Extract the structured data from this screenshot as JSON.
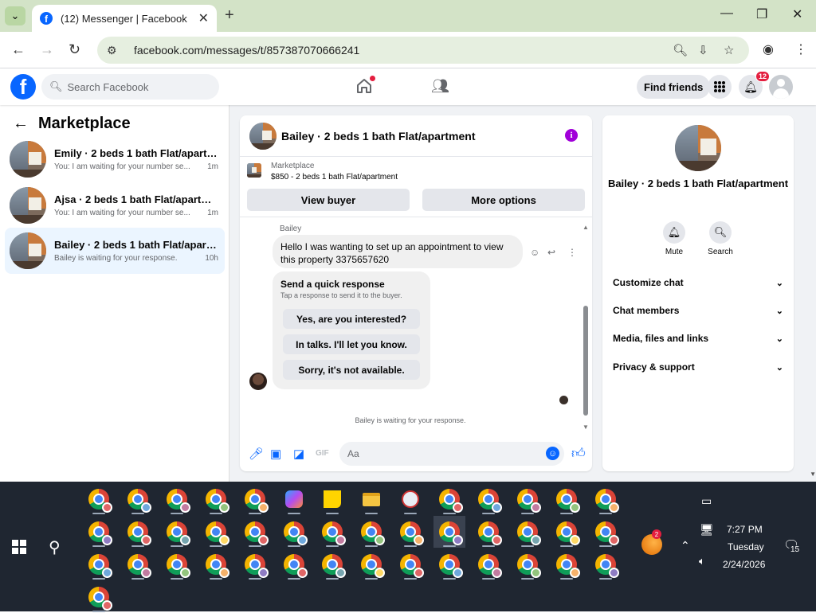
{
  "browser": {
    "tab_title": "(12) Messenger | Facebook",
    "url": "facebook.com/messages/t/857387070666241"
  },
  "fb_header": {
    "search_placeholder": "Search Facebook",
    "find_friends": "Find friends",
    "notification_count": "12"
  },
  "left": {
    "title": "Marketplace",
    "conversations": [
      {
        "name": "Emily · 2 beds 1 bath Flat/apartment",
        "snippet": "You: I am waiting for your number se...",
        "time": "1m",
        "active": false
      },
      {
        "name": "Ajsa · 2 beds 1 bath Flat/apartment",
        "snippet": "You: I am waiting for your number se...",
        "time": "1m",
        "active": false
      },
      {
        "name": "Bailey · 2 beds 1 bath Flat/apartme...",
        "snippet": "Bailey is waiting for your response.",
        "time": "10h",
        "active": true
      }
    ]
  },
  "chat": {
    "title": "Bailey · 2 beds 1 bath Flat/apartment",
    "marketplace_label": "Marketplace",
    "listing": "$850 - 2 beds 1 bath Flat/apartment",
    "view_buyer": "View buyer",
    "more_options": "More options",
    "sender": "Bailey",
    "message": "Hello I was wanting to set up an appointment to view this property 3375657620",
    "quick_title": "Send a quick response",
    "quick_sub": "Tap a response to send it to the buyer.",
    "quick_responses": [
      "Yes, are you interested?",
      "In talks. I'll let you know.",
      "Sorry, it's not available."
    ],
    "waiting": "Bailey is waiting for your response.",
    "composer_placeholder": "Aa"
  },
  "right": {
    "title": "Bailey · 2 beds 1 bath Flat/apartment",
    "mute": "Mute",
    "search": "Search",
    "sections": [
      "Customize chat",
      "Chat members",
      "Media, files and links",
      "Privacy & support"
    ]
  },
  "taskbar": {
    "time": "7:27 PM",
    "day": "Tuesday",
    "date": "2/24/2026",
    "notifications": "15",
    "copilot_badge": "2"
  },
  "colors": {
    "fb_blue": "#0866ff",
    "badge_red": "#e41e3f",
    "info_purple": "#a100d9",
    "taskbar_bg": "#1f2631"
  }
}
